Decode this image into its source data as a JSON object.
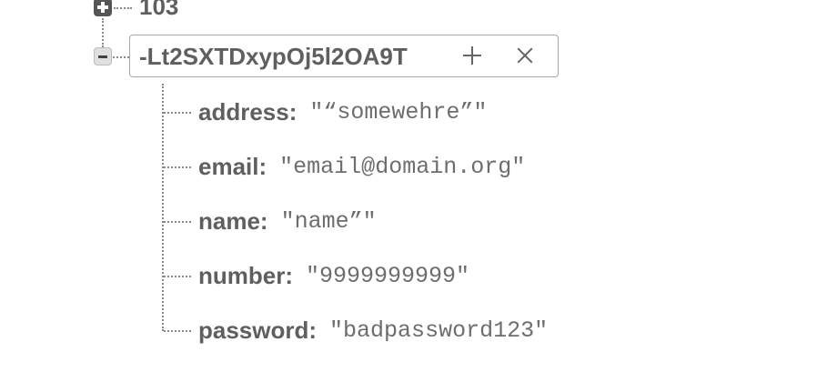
{
  "tree": {
    "parent_sibling": {
      "label": "103"
    },
    "selected_node": {
      "key": "-Lt2SXTDxypOj5l2OA9T",
      "add_icon": "plus-icon",
      "remove_icon": "close-icon"
    },
    "separator": ":",
    "children": [
      {
        "key": "address",
        "value": "\"“somewehre”\""
      },
      {
        "key": "email",
        "value": "\"email@domain.org\""
      },
      {
        "key": "name",
        "value": "\"name”\""
      },
      {
        "key": "number",
        "value": "\"9999999999\""
      },
      {
        "key": "password",
        "value": "\"badpassword123\""
      }
    ]
  }
}
